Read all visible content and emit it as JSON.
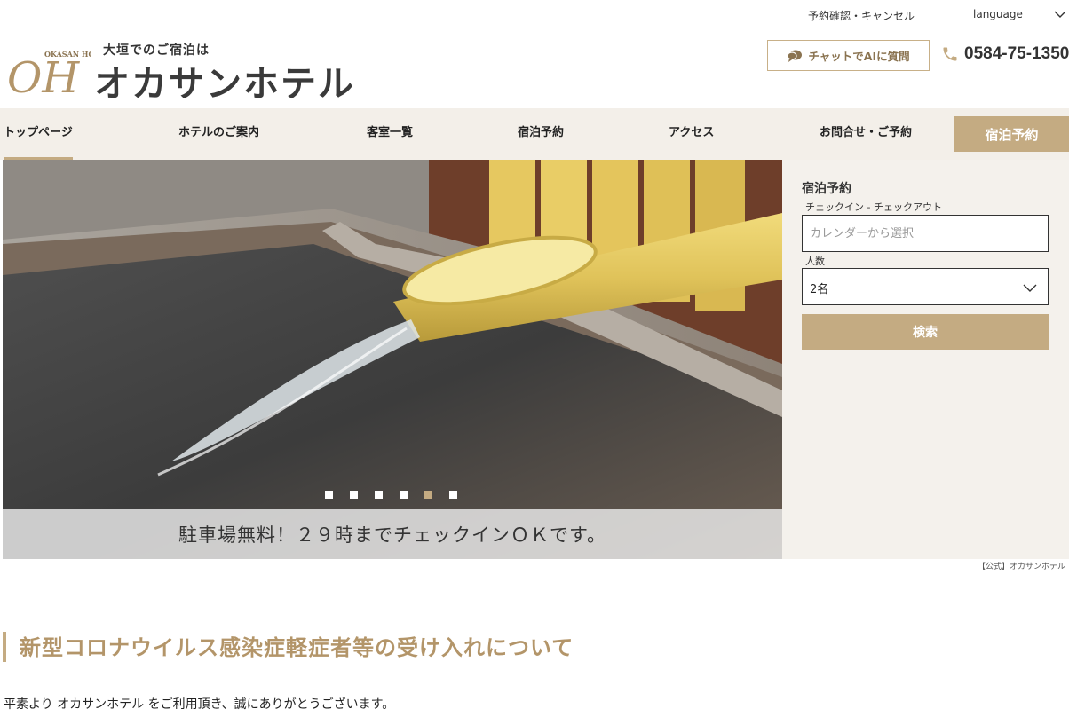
{
  "utility": {
    "confirm_cancel": "予約確認・キャンセル",
    "language": "language"
  },
  "header": {
    "logo_mark_text": "OKASAN HOTEL",
    "logo_initials": "OH",
    "logo_tagline": "大垣でのご宿泊は",
    "logo_name": "オカサンホテル",
    "chat_button": "チャットでAIに質問",
    "phone": "0584-75-1350"
  },
  "nav": {
    "items": [
      {
        "label": "トップページ",
        "active": true
      },
      {
        "label": "ホテルのご案内"
      },
      {
        "label": "客室一覧"
      },
      {
        "label": "宿泊予約"
      },
      {
        "label": "アクセス"
      },
      {
        "label": "お問合せ・ご予約"
      }
    ],
    "book_button": "宿泊予約"
  },
  "hero": {
    "caption": "駐車場無料！２９時までチェックインＯＫです。",
    "slide_count": 6,
    "active_slide": 5
  },
  "booking": {
    "title": "宿泊予約",
    "dates_label": "チェックイン - チェックアウト",
    "dates_placeholder": "カレンダーから選択",
    "guests_label": "人数",
    "guests_value": "2名",
    "search_button": "検索"
  },
  "footer_note": "【公式】オカサンホテル",
  "notice": {
    "title": "新型コロナウイルス感染症軽症者等の受け入れについて",
    "body": "平素より オカサンホテル をご利用頂き、誠にありがとうございます。"
  },
  "colors": {
    "accent": "#c4ab82",
    "nav_bg": "#f3efe9",
    "notice_title": "#b39569"
  }
}
